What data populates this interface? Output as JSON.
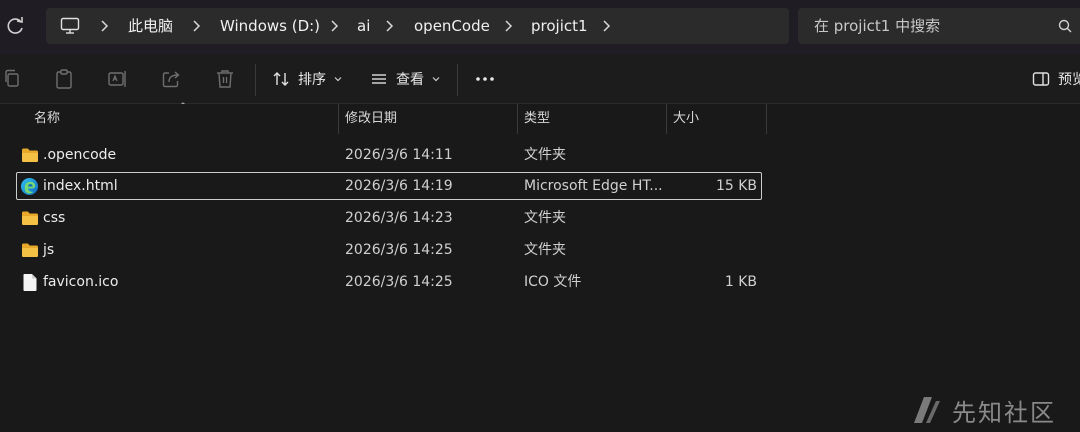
{
  "breadcrumb": {
    "items": [
      "此电脑",
      "Windows (D:)",
      "ai",
      "openCode",
      "projict1"
    ]
  },
  "search": {
    "placeholder": "在 projict1 中搜索"
  },
  "toolbar": {
    "sort_label": "排序",
    "view_label": "查看",
    "preview_label": "预览"
  },
  "columns": {
    "name": "名称",
    "date": "修改日期",
    "type": "类型",
    "size": "大小"
  },
  "files": [
    {
      "name": ".opencode",
      "date": "2026/3/6 14:11",
      "type": "文件夹",
      "size": "",
      "icon": "folder-icon"
    },
    {
      "name": "index.html",
      "date": "2026/3/6 14:19",
      "type": "Microsoft Edge HT...",
      "size": "15 KB",
      "icon": "edge-icon",
      "selected": true
    },
    {
      "name": "css",
      "date": "2026/3/6 14:23",
      "type": "文件夹",
      "size": "",
      "icon": "folder-icon"
    },
    {
      "name": "js",
      "date": "2026/3/6 14:25",
      "type": "文件夹",
      "size": "",
      "icon": "folder-icon"
    },
    {
      "name": "favicon.ico",
      "date": "2026/3/6 14:25",
      "type": "ICO 文件",
      "size": "1 KB",
      "icon": "file-icon"
    }
  ],
  "watermark": {
    "text": "先知社区"
  },
  "colors": {
    "background": "#191919",
    "address_bar": "#201c24",
    "folder": "#f4c144",
    "selection_border": "#cccccc"
  }
}
